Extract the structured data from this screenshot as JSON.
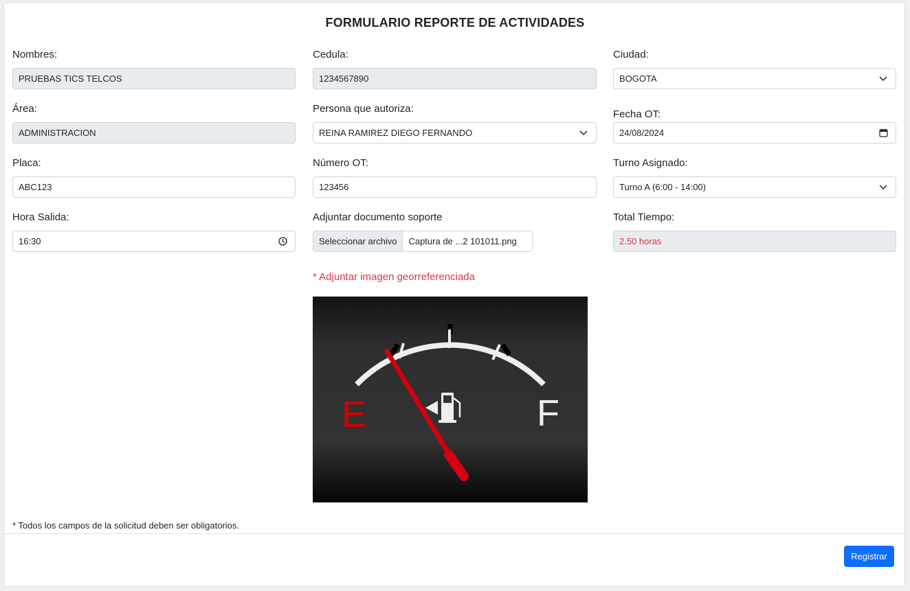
{
  "form": {
    "title": "FORMULARIO REPORTE DE ACTIVIDADES",
    "nombres": {
      "label": "Nombres:",
      "value": "PRUEBAS TICS TELCOS"
    },
    "cedula": {
      "label": "Cedula:",
      "value": "1234567890"
    },
    "ciudad": {
      "label": "Ciudad:",
      "value": "BOGOTA"
    },
    "area": {
      "label": "Área:",
      "value": "ADMINISTRACION"
    },
    "autoriza": {
      "label": "Persona que autoriza:",
      "value": "REINA RAMIREZ DIEGO FERNANDO"
    },
    "fecha_ot": {
      "label": "Fecha OT:",
      "value": "24/08/2024"
    },
    "placa": {
      "label": "Placa:",
      "value": "ABC123"
    },
    "numero_ot": {
      "label": "Número OT:",
      "value": "123456"
    },
    "turno": {
      "label": "Turno Asignado:",
      "value": "Turno A (6:00 - 14:00)"
    },
    "hora_salida": {
      "label": "Hora Salida:",
      "value": "16:30"
    },
    "adjunto": {
      "label": "Adjuntar documento soporte",
      "button": "Seleccionar archivo",
      "filename": "Captura de ...2 101011.png"
    },
    "total_tiempo": {
      "label": "Total Tiempo:",
      "value": "2.50 horas"
    },
    "geo_warning": "* Adjuntar imagen georreferenciada",
    "footnote": "* Todos los campos de la solicitud deben ser obligatorios.",
    "submit": "Registrar"
  },
  "gauge_image": {
    "empty_label": "E",
    "full_label": "F",
    "level": 0.05
  },
  "colors": {
    "primary": "#0d6efd",
    "danger": "#dc3545",
    "readonly_bg": "#e9ecef"
  }
}
